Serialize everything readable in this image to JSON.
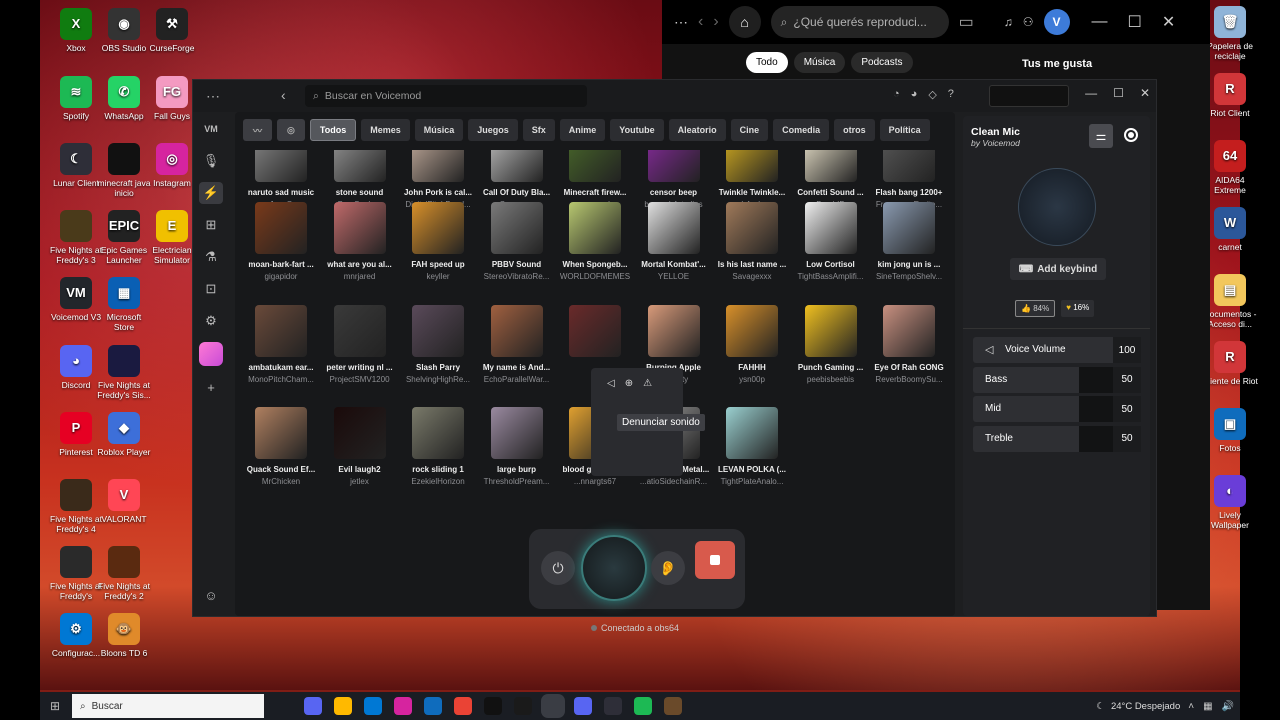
{
  "desktop_left": [
    {
      "label": "Xbox",
      "color": "#107c10",
      "glyph": "X"
    },
    {
      "label": "OBS Studio",
      "color": "#333333",
      "glyph": "◉"
    },
    {
      "label": "CurseForge",
      "color": "#222222",
      "glyph": "⚒"
    },
    {
      "label": "Spotify",
      "color": "#1db954",
      "glyph": "≋"
    },
    {
      "label": "WhatsApp",
      "color": "#25d366",
      "glyph": "✆"
    },
    {
      "label": "Fall Guys",
      "color": "#f49ac1",
      "glyph": "FG"
    },
    {
      "label": "Lunar Client",
      "color": "#2e2e38",
      "glyph": "☾"
    },
    {
      "label": "minecraft java inicio",
      "color": "#111111",
      "glyph": ""
    },
    {
      "label": "Instagram",
      "color": "#d6249f",
      "glyph": "◎"
    },
    {
      "label": "Five Nights at Freddy's 3",
      "color": "#4a3a1a",
      "glyph": ""
    },
    {
      "label": "Epic Games Launcher",
      "color": "#222222",
      "glyph": "EPIC"
    },
    {
      "label": "Electrician Simulator",
      "color": "#f0c000",
      "glyph": "E"
    },
    {
      "label": "Voicemod V3",
      "color": "#22262b",
      "glyph": "VM"
    },
    {
      "label": "Microsoft Store",
      "color": "#0a5fb4",
      "glyph": "▦"
    },
    {
      "label": "Discord",
      "color": "#5865f2",
      "glyph": "◕"
    },
    {
      "label": "Five Nights at Freddy's Sis...",
      "color": "#1a1a40",
      "glyph": ""
    },
    {
      "label": "Pinterest",
      "color": "#e60023",
      "glyph": "P"
    },
    {
      "label": "Roblox Player",
      "color": "#3d6fd9",
      "glyph": "◆"
    },
    {
      "label": "Five Nights at Freddy's 4",
      "color": "#3a2a1a",
      "glyph": ""
    },
    {
      "label": "VALORANT",
      "color": "#ff4655",
      "glyph": "V"
    },
    {
      "label": "Five Nights at Freddy's",
      "color": "#2a2a2a",
      "glyph": ""
    },
    {
      "label": "Five Nights at Freddy's 2",
      "color": "#5a2a10",
      "glyph": ""
    },
    {
      "label": "Configurac...",
      "color": "#0078d4",
      "glyph": "⚙"
    },
    {
      "label": "Bloons TD 6",
      "color": "#e08a2a",
      "glyph": "🐵"
    }
  ],
  "desktop_right": [
    {
      "label": "Papelera de reciclaje",
      "color": "#8fb4d8",
      "glyph": "🗑"
    },
    {
      "label": "Riot Client",
      "color": "#d13639",
      "glyph": "R"
    },
    {
      "label": "AIDA64 Extreme",
      "color": "#c41e1e",
      "glyph": "64"
    },
    {
      "label": "carnet",
      "color": "#2b579a",
      "glyph": "W"
    },
    {
      "label": "Documentos - Acceso di...",
      "color": "#f2c75c",
      "glyph": "▤"
    },
    {
      "label": "Cliente de Riot",
      "color": "#d13639",
      "glyph": "R"
    },
    {
      "label": "Fotos",
      "color": "#0f6cbd",
      "glyph": "▣"
    },
    {
      "label": "Lively Wallpaper",
      "color": "#6a3dd8",
      "glyph": "◐"
    }
  ],
  "spotify": {
    "search_placeholder": "¿Qué querés reproduci...",
    "avatar": "V",
    "chips": [
      "Todo",
      "Música",
      "Podcasts"
    ],
    "likes_title": "Tus me gusta"
  },
  "voicemod": {
    "search_placeholder": "Buscar en Voicemod",
    "categories": [
      "Todos",
      "Memes",
      "Música",
      "Juegos",
      "Sfx",
      "Anime",
      "Youtube",
      "Aleatorio",
      "Cine",
      "Comedia",
      "otros",
      "Política"
    ],
    "sounds": [
      {
        "name": "naruto sad music",
        "author": "JoeyQ",
        "color": "#8a8a8a"
      },
      {
        "name": "stone sound",
        "author": "BomSonhos",
        "color": "#9a9a9a"
      },
      {
        "name": "John Pork is cal...",
        "author": "DigitalPitchBand...",
        "color": "#c8b0a0"
      },
      {
        "name": "Call Of Duty Bla...",
        "author": "Cosmooo",
        "color": "#c0c0c0"
      },
      {
        "name": "Minecraft firew...",
        "author": "zeromesh",
        "color": "#4a6a2a"
      },
      {
        "name": "censor beep",
        "author": "bryanek4studios",
        "color": "#8a2aa0"
      },
      {
        "name": "Twinkle Twinkle...",
        "author": "h4ych",
        "color": "#d8b020"
      },
      {
        "name": "Confetti Sound ...",
        "author": "BumbIB",
        "color": "#f0e8d0"
      },
      {
        "name": "Flash bang 1200+",
        "author": "FrequencyExcite...",
        "color": "#5a5a5a"
      },
      {
        "name": "moan-bark-fart ...",
        "author": "gigapidor",
        "color": "#7a3a1a"
      },
      {
        "name": "what are you al...",
        "author": "mnrjared",
        "color": "#c06a6a"
      },
      {
        "name": "FAH speed up",
        "author": "keyller",
        "color": "#d8902a"
      },
      {
        "name": "PBBV Sound",
        "author": "StereoVibratoRe...",
        "color": "#7a7a7a"
      },
      {
        "name": "When Spongeb...",
        "author": "WORLDOFMEMES",
        "color": "#b8c870"
      },
      {
        "name": "Mortal Kombat'...",
        "author": "YELLOE",
        "color": "#e0e0e0"
      },
      {
        "name": "Is his last name ...",
        "author": "Savagexxx",
        "color": "#a07a5a"
      },
      {
        "name": "Low Cortisol",
        "author": "TightBassAmplifi...",
        "color": "#f0f0f0"
      },
      {
        "name": "kim jong un is ...",
        "author": "SineTempoShelv...",
        "color": "#8a9ab0"
      },
      {
        "name": "ambatukam ear...",
        "author": "MonoPitchCham...",
        "color": "#6a4a3a"
      },
      {
        "name": "peter writing nl ...",
        "author": "ProjectSMV1200",
        "color": "#3a3a3a"
      },
      {
        "name": "Slash Parry",
        "author": "ShelvingHighRe...",
        "color": "#5a4a5a"
      },
      {
        "name": "My name is And...",
        "author": "EchoParallelWar...",
        "color": "#a06040"
      },
      {
        "name": "",
        "author": "",
        "color": "#6a2a2a"
      },
      {
        "name": "Burping Apple",
        "author": "weamity",
        "color": "#d89a7a"
      },
      {
        "name": "FAHHH",
        "author": "ysn00p",
        "color": "#d8902a"
      },
      {
        "name": "Punch Gaming ...",
        "author": "peebisbeebis",
        "color": "#f0c020"
      },
      {
        "name": "Eye Of Rah GONG",
        "author": "ReverbBoomySu...",
        "color": "#c89080"
      },
      {
        "name": "Quack Sound Ef...",
        "author": "MrChicken",
        "color": "#b08060"
      },
      {
        "name": "Evil laugh2",
        "author": "jetlex",
        "color": "#1a0a0a"
      },
      {
        "name": "rock sliding 1",
        "author": "EzekielHorizon",
        "color": "#7a7a6a"
      },
      {
        "name": "large burp",
        "author": "ThresholdPream...",
        "color": "#9a8aa0"
      },
      {
        "name": "blood gore bon...",
        "author": "...nnargts67",
        "color": "#e0a030"
      },
      {
        "name": "...mpact on Metal...",
        "author": "...atioSidechainR...",
        "color": "#9a9a9a"
      },
      {
        "name": "LEVAN POLKA (...",
        "author": "TightPlateAnalo...",
        "color": "#9ad0d0"
      }
    ],
    "tooltip": "Denunciar sonido",
    "connection": "Conectado a obs64",
    "panel": {
      "title": "Clean Mic",
      "subtitle": "by Voicemod",
      "keybind": "Add keybind",
      "vote_up": "84%",
      "vote_gold": "16%",
      "sliders": [
        {
          "label": "Voice Volume",
          "value": "100",
          "level": 1.0
        },
        {
          "label": "Bass",
          "value": "50",
          "level": 0.5
        },
        {
          "label": "Mid",
          "value": "50",
          "level": 0.5
        },
        {
          "label": "Treble",
          "value": "50",
          "level": 0.5
        }
      ]
    }
  },
  "taskbar": {
    "search": "Buscar",
    "weather": "24°C  Despejado"
  }
}
